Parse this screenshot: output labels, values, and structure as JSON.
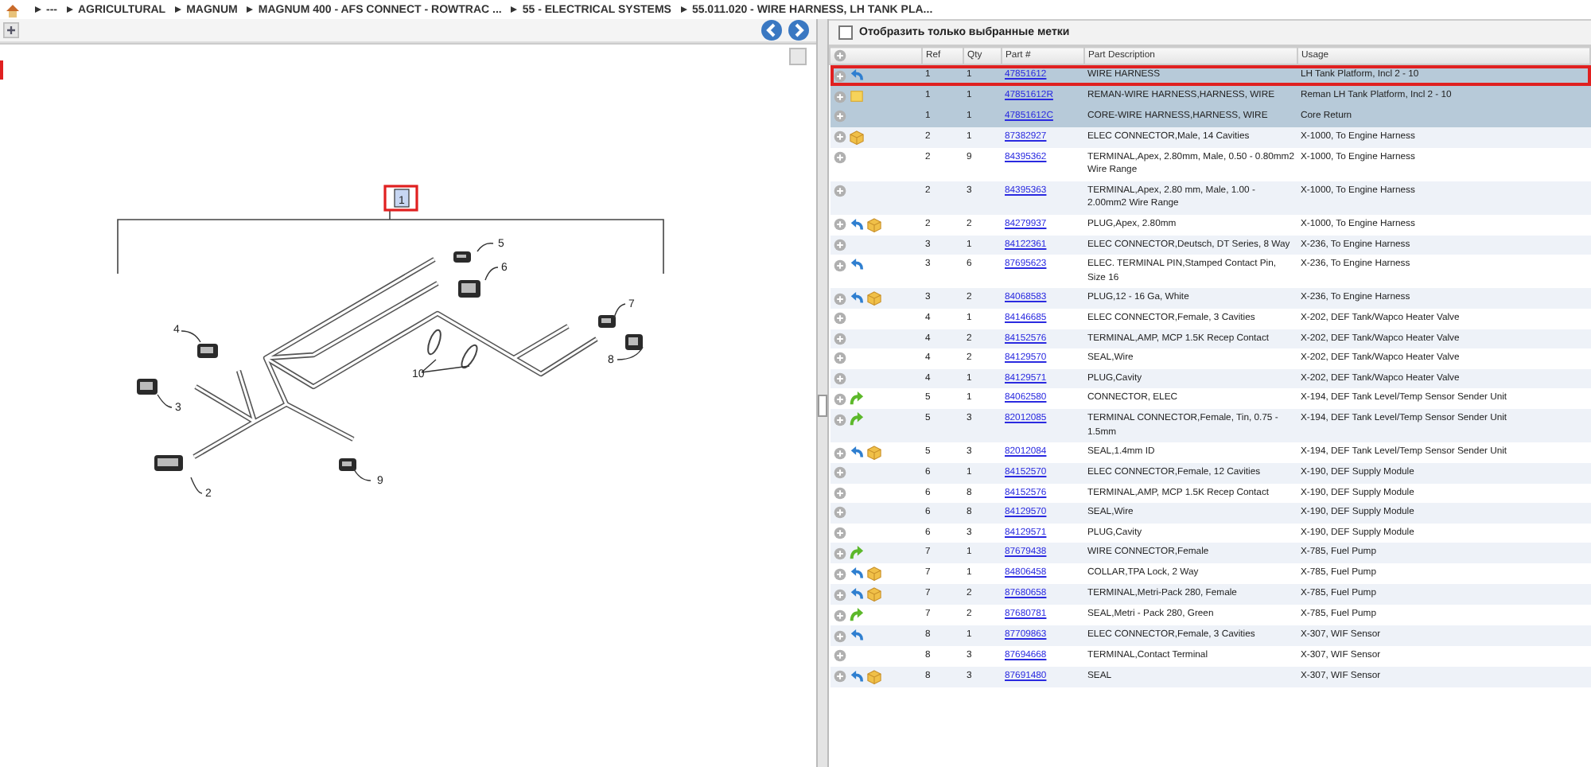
{
  "breadcrumb": [
    "---",
    "AGRICULTURAL",
    "MAGNUM",
    "MAGNUM 400 - AFS CONNECT - ROWTRAC ...",
    "55 - ELECTRICAL SYSTEMS",
    "55.011.020 - WIRE HARNESS, LH TANK PLA..."
  ],
  "diagram": {
    "callouts": [
      {
        "label": "1",
        "selected": true
      },
      {
        "label": "2"
      },
      {
        "label": "3"
      },
      {
        "label": "4"
      },
      {
        "label": "5"
      },
      {
        "label": "6"
      },
      {
        "label": "7"
      },
      {
        "label": "8"
      },
      {
        "label": "9"
      },
      {
        "label": "10"
      }
    ]
  },
  "filter": {
    "label": "Отобразить только выбранные метки",
    "checked": false
  },
  "table": {
    "columns": [
      "Ref",
      "Qty",
      "Part #",
      "Part Description",
      "Usage"
    ],
    "rows": [
      {
        "icons": [
          {
            "kind": "back"
          }
        ],
        "ref": "1",
        "qty": "1",
        "part": "47851612",
        "description": "WIRE HARNESS",
        "usage": "LH Tank Platform, Incl 2 - 10",
        "selected": true,
        "outlined": true
      },
      {
        "icons": [
          {
            "kind": "note"
          }
        ],
        "ref": "1",
        "qty": "1",
        "part": "47851612R",
        "description": "REMAN-WIRE HARNESS,HARNESS, WIRE",
        "usage": "Reman LH Tank Platform, Incl 2 - 10",
        "selected": true,
        "outlined": false
      },
      {
        "icons": [],
        "ref": "1",
        "qty": "1",
        "part": "47851612C",
        "description": "CORE-WIRE HARNESS,HARNESS, WIRE",
        "usage": "Core Return",
        "selected": true,
        "outlined": false
      },
      {
        "icons": [
          {
            "kind": "box"
          }
        ],
        "ref": "2",
        "qty": "1",
        "part": "87382927",
        "description": "ELEC CONNECTOR,Male, 14 Cavities",
        "usage": "X-1000, To Engine Harness",
        "selected": false,
        "outlined": false
      },
      {
        "icons": [],
        "ref": "2",
        "qty": "9",
        "part": "84395362",
        "description": "TERMINAL,Apex, 2.80mm, Male, 0.50 - 0.80mm2 Wire Range",
        "usage": "X-1000, To Engine Harness",
        "selected": false,
        "outlined": false
      },
      {
        "icons": [],
        "ref": "2",
        "qty": "3",
        "part": "84395363",
        "description": "TERMINAL,Apex, 2.80 mm, Male, 1.00 - 2.00mm2 Wire Range",
        "usage": "X-1000, To Engine Harness",
        "selected": false,
        "outlined": false
      },
      {
        "icons": [
          {
            "kind": "back"
          },
          {
            "kind": "box"
          }
        ],
        "ref": "2",
        "qty": "2",
        "part": "84279937",
        "description": "PLUG,Apex, 2.80mm",
        "usage": "X-1000, To Engine Harness",
        "selected": false,
        "outlined": false
      },
      {
        "icons": [],
        "ref": "3",
        "qty": "1",
        "part": "84122361",
        "description": "ELEC CONNECTOR,Deutsch, DT Series, 8 Way",
        "usage": "X-236, To Engine Harness",
        "selected": false,
        "outlined": false
      },
      {
        "icons": [
          {
            "kind": "back"
          }
        ],
        "ref": "3",
        "qty": "6",
        "part": "87695623",
        "description": "ELEC. TERMINAL PIN,Stamped Contact Pin, Size 16",
        "usage": "X-236, To Engine Harness",
        "selected": false,
        "outlined": false
      },
      {
        "icons": [
          {
            "kind": "back"
          },
          {
            "kind": "box"
          }
        ],
        "ref": "3",
        "qty": "2",
        "part": "84068583",
        "description": "PLUG,12 - 16 Ga, White",
        "usage": "X-236, To Engine Harness",
        "selected": false,
        "outlined": false
      },
      {
        "icons": [],
        "ref": "4",
        "qty": "1",
        "part": "84146685",
        "description": "ELEC CONNECTOR,Female, 3 Cavities",
        "usage": "X-202, DEF Tank/Wapco Heater Valve",
        "selected": false,
        "outlined": false
      },
      {
        "icons": [],
        "ref": "4",
        "qty": "2",
        "part": "84152576",
        "description": "TERMINAL,AMP, MCP 1.5K Recep Contact",
        "usage": "X-202, DEF Tank/Wapco Heater Valve",
        "selected": false,
        "outlined": false
      },
      {
        "icons": [],
        "ref": "4",
        "qty": "2",
        "part": "84129570",
        "description": "SEAL,Wire",
        "usage": "X-202, DEF Tank/Wapco Heater Valve",
        "selected": false,
        "outlined": false
      },
      {
        "icons": [],
        "ref": "4",
        "qty": "1",
        "part": "84129571",
        "description": "PLUG,Cavity",
        "usage": "X-202, DEF Tank/Wapco Heater Valve",
        "selected": false,
        "outlined": false
      },
      {
        "icons": [
          {
            "kind": "forward"
          }
        ],
        "ref": "5",
        "qty": "1",
        "part": "84062580",
        "description": "CONNECTOR, ELEC",
        "usage": "X-194, DEF Tank Level/Temp Sensor Sender Unit",
        "selected": false,
        "outlined": false
      },
      {
        "icons": [
          {
            "kind": "forward"
          }
        ],
        "ref": "5",
        "qty": "3",
        "part": "82012085",
        "description": "TERMINAL CONNECTOR,Female, Tin, 0.75 - 1.5mm",
        "usage": "X-194, DEF Tank Level/Temp Sensor Sender Unit",
        "selected": false,
        "outlined": false
      },
      {
        "icons": [
          {
            "kind": "back"
          },
          {
            "kind": "box"
          }
        ],
        "ref": "5",
        "qty": "3",
        "part": "82012084",
        "description": "SEAL,1.4mm ID",
        "usage": "X-194, DEF Tank Level/Temp Sensor Sender Unit",
        "selected": false,
        "outlined": false
      },
      {
        "icons": [],
        "ref": "6",
        "qty": "1",
        "part": "84152570",
        "description": "ELEC CONNECTOR,Female, 12 Cavities",
        "usage": "X-190, DEF Supply Module",
        "selected": false,
        "outlined": false
      },
      {
        "icons": [],
        "ref": "6",
        "qty": "8",
        "part": "84152576",
        "description": "TERMINAL,AMP, MCP 1.5K Recep Contact",
        "usage": "X-190, DEF Supply Module",
        "selected": false,
        "outlined": false
      },
      {
        "icons": [],
        "ref": "6",
        "qty": "8",
        "part": "84129570",
        "description": "SEAL,Wire",
        "usage": "X-190, DEF Supply Module",
        "selected": false,
        "outlined": false
      },
      {
        "icons": [],
        "ref": "6",
        "qty": "3",
        "part": "84129571",
        "description": "PLUG,Cavity",
        "usage": "X-190, DEF Supply Module",
        "selected": false,
        "outlined": false
      },
      {
        "icons": [
          {
            "kind": "forward"
          }
        ],
        "ref": "7",
        "qty": "1",
        "part": "87679438",
        "description": "WIRE CONNECTOR,Female",
        "usage": "X-785, Fuel Pump",
        "selected": false,
        "outlined": false
      },
      {
        "icons": [
          {
            "kind": "back"
          },
          {
            "kind": "box"
          }
        ],
        "ref": "7",
        "qty": "1",
        "part": "84806458",
        "description": "COLLAR,TPA Lock, 2 Way",
        "usage": "X-785, Fuel Pump",
        "selected": false,
        "outlined": false
      },
      {
        "icons": [
          {
            "kind": "back"
          },
          {
            "kind": "box"
          }
        ],
        "ref": "7",
        "qty": "2",
        "part": "87680658",
        "description": "TERMINAL,Metri-Pack 280, Female",
        "usage": "X-785, Fuel Pump",
        "selected": false,
        "outlined": false
      },
      {
        "icons": [
          {
            "kind": "forward"
          }
        ],
        "ref": "7",
        "qty": "2",
        "part": "87680781",
        "description": "SEAL,Metri - Pack 280, Green",
        "usage": "X-785, Fuel Pump",
        "selected": false,
        "outlined": false
      },
      {
        "icons": [
          {
            "kind": "back"
          }
        ],
        "ref": "8",
        "qty": "1",
        "part": "87709863",
        "description": "ELEC CONNECTOR,Female, 3 Cavities",
        "usage": "X-307, WIF Sensor",
        "selected": false,
        "outlined": false
      },
      {
        "icons": [],
        "ref": "8",
        "qty": "3",
        "part": "87694668",
        "description": "TERMINAL,Contact Terminal",
        "usage": "X-307, WIF Sensor",
        "selected": false,
        "outlined": false
      },
      {
        "icons": [
          {
            "kind": "back"
          },
          {
            "kind": "box"
          }
        ],
        "ref": "8",
        "qty": "3",
        "part": "87691480",
        "description": "SEAL",
        "usage": "X-307, WIF Sensor",
        "selected": false,
        "outlined": false
      }
    ]
  }
}
